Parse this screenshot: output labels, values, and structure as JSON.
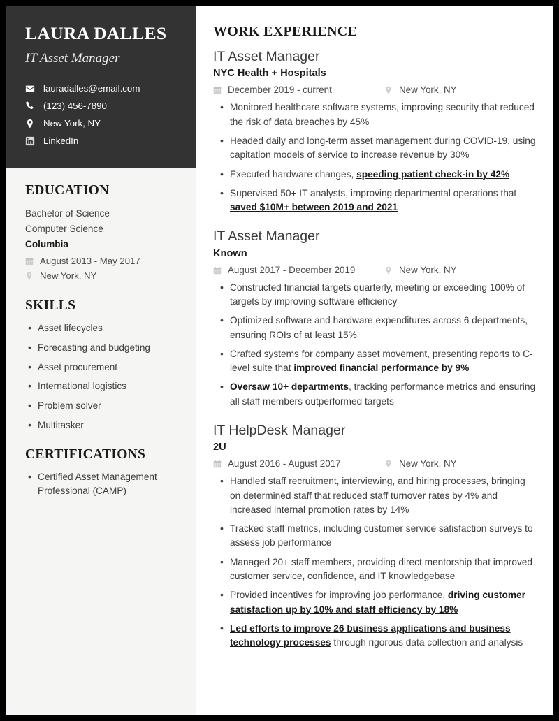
{
  "sidebar": {
    "name": "LAURA DALLES",
    "headline": "IT Asset Manager",
    "contact": [
      {
        "icon": "envelope-icon",
        "text": "lauradalles@email.com",
        "link": false
      },
      {
        "icon": "phone-icon",
        "text": "(123) 456-7890",
        "link": false
      },
      {
        "icon": "location-pin-icon",
        "text": "New York, NY",
        "link": false
      },
      {
        "icon": "linkedin-icon",
        "text": "LinkedIn",
        "link": true
      }
    ],
    "education": {
      "heading": "EDUCATION",
      "degree": "Bachelor of Science",
      "field": "Computer Science",
      "school": "Columbia",
      "dates": "August 2013 - May 2017",
      "location": "New York, NY"
    },
    "skills": {
      "heading": "SKILLS",
      "items": [
        "Asset lifecycles",
        "Forecasting and budgeting",
        "Asset procurement",
        "International logistics",
        "Problem solver",
        "Multitasker"
      ]
    },
    "certifications": {
      "heading": "CERTIFICATIONS",
      "items": [
        "Certified Asset Management Professional (CAMP)"
      ]
    }
  },
  "main": {
    "heading": "WORK EXPERIENCE",
    "jobs": [
      {
        "title": "IT Asset Manager",
        "company": "NYC Health + Hospitals",
        "dates": "December 2019 - current",
        "location": "New York, NY",
        "bullets": [
          [
            {
              "t": "Monitored healthcare software systems, improving security that reduced the risk of data breaches by 45%",
              "hl": false
            }
          ],
          [
            {
              "t": "Headed daily and long-term asset management during COVID-19, using capitation models of service to increase revenue by 30%",
              "hl": false
            }
          ],
          [
            {
              "t": "Executed hardware changes, ",
              "hl": false
            },
            {
              "t": "speeding patient check-in by 42%",
              "hl": true
            }
          ],
          [
            {
              "t": "Supervised 50+ IT analysts, improving departmental operations that ",
              "hl": false
            },
            {
              "t": "saved $10M+ between 2019 and 2021",
              "hl": true
            }
          ]
        ]
      },
      {
        "title": "IT Asset Manager",
        "company": "Known",
        "dates": "August 2017 - December 2019",
        "location": "New York, NY",
        "bullets": [
          [
            {
              "t": "Constructed financial targets quarterly, meeting or exceeding 100% of targets by improving software efficiency",
              "hl": false
            }
          ],
          [
            {
              "t": "Optimized software and hardware expenditures across 6 departments, ensuring ROIs of at least 15%",
              "hl": false
            }
          ],
          [
            {
              "t": "Crafted systems for company asset movement, presenting reports to C-level suite that ",
              "hl": false
            },
            {
              "t": "improved financial performance by 9%",
              "hl": true
            }
          ],
          [
            {
              "t": "Oversaw 10+ departments",
              "hl": true
            },
            {
              "t": ", tracking performance metrics and ensuring all staff members outperformed targets",
              "hl": false
            }
          ]
        ]
      },
      {
        "title": "IT HelpDesk Manager",
        "company": "2U",
        "dates": "August 2016 - August 2017",
        "location": "New York, NY",
        "bullets": [
          [
            {
              "t": "Handled staff recruitment, interviewing, and hiring processes, bringing on determined staff that reduced staff turnover rates by 4% and increased internal promotion rates by 14%",
              "hl": false
            }
          ],
          [
            {
              "t": "Tracked staff metrics, including customer service satisfaction surveys to assess job performance",
              "hl": false
            }
          ],
          [
            {
              "t": "Managed 20+ staff members, providing direct mentorship that improved customer service, confidence, and IT knowledgebase",
              "hl": false
            }
          ],
          [
            {
              "t": "Provided incentives for improving job performance, ",
              "hl": false
            },
            {
              "t": "driving customer satisfaction up by 10% and staff efficiency by 18%",
              "hl": true
            }
          ],
          [
            {
              "t": "Led efforts to improve 26 business applications and business technology processes",
              "hl": true
            },
            {
              "t": " through rigorous data collection and analysis",
              "hl": false
            }
          ]
        ]
      }
    ]
  },
  "colors": {
    "header_bg": "#333333",
    "sidebar_bg": "#f5f5f4",
    "page_bg": "#ffffff",
    "frame": "#000000",
    "text_dark": "#1a1a1a",
    "text_body": "#3d3d3d"
  }
}
